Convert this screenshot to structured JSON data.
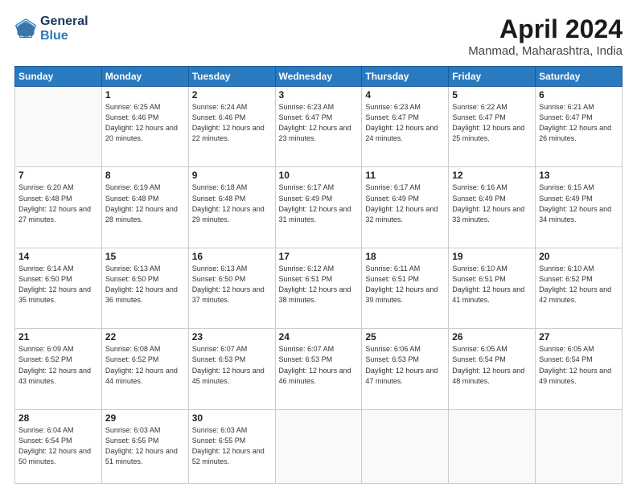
{
  "header": {
    "logo_line1": "General",
    "logo_line2": "Blue",
    "month_year": "April 2024",
    "location": "Manmad, Maharashtra, India"
  },
  "weekdays": [
    "Sunday",
    "Monday",
    "Tuesday",
    "Wednesday",
    "Thursday",
    "Friday",
    "Saturday"
  ],
  "weeks": [
    [
      {
        "day": "",
        "sunrise": "",
        "sunset": "",
        "daylight": ""
      },
      {
        "day": "1",
        "sunrise": "Sunrise: 6:25 AM",
        "sunset": "Sunset: 6:46 PM",
        "daylight": "Daylight: 12 hours and 20 minutes."
      },
      {
        "day": "2",
        "sunrise": "Sunrise: 6:24 AM",
        "sunset": "Sunset: 6:46 PM",
        "daylight": "Daylight: 12 hours and 22 minutes."
      },
      {
        "day": "3",
        "sunrise": "Sunrise: 6:23 AM",
        "sunset": "Sunset: 6:47 PM",
        "daylight": "Daylight: 12 hours and 23 minutes."
      },
      {
        "day": "4",
        "sunrise": "Sunrise: 6:23 AM",
        "sunset": "Sunset: 6:47 PM",
        "daylight": "Daylight: 12 hours and 24 minutes."
      },
      {
        "day": "5",
        "sunrise": "Sunrise: 6:22 AM",
        "sunset": "Sunset: 6:47 PM",
        "daylight": "Daylight: 12 hours and 25 minutes."
      },
      {
        "day": "6",
        "sunrise": "Sunrise: 6:21 AM",
        "sunset": "Sunset: 6:47 PM",
        "daylight": "Daylight: 12 hours and 26 minutes."
      }
    ],
    [
      {
        "day": "7",
        "sunrise": "Sunrise: 6:20 AM",
        "sunset": "Sunset: 6:48 PM",
        "daylight": "Daylight: 12 hours and 27 minutes."
      },
      {
        "day": "8",
        "sunrise": "Sunrise: 6:19 AM",
        "sunset": "Sunset: 6:48 PM",
        "daylight": "Daylight: 12 hours and 28 minutes."
      },
      {
        "day": "9",
        "sunrise": "Sunrise: 6:18 AM",
        "sunset": "Sunset: 6:48 PM",
        "daylight": "Daylight: 12 hours and 29 minutes."
      },
      {
        "day": "10",
        "sunrise": "Sunrise: 6:17 AM",
        "sunset": "Sunset: 6:49 PM",
        "daylight": "Daylight: 12 hours and 31 minutes."
      },
      {
        "day": "11",
        "sunrise": "Sunrise: 6:17 AM",
        "sunset": "Sunset: 6:49 PM",
        "daylight": "Daylight: 12 hours and 32 minutes."
      },
      {
        "day": "12",
        "sunrise": "Sunrise: 6:16 AM",
        "sunset": "Sunset: 6:49 PM",
        "daylight": "Daylight: 12 hours and 33 minutes."
      },
      {
        "day": "13",
        "sunrise": "Sunrise: 6:15 AM",
        "sunset": "Sunset: 6:49 PM",
        "daylight": "Daylight: 12 hours and 34 minutes."
      }
    ],
    [
      {
        "day": "14",
        "sunrise": "Sunrise: 6:14 AM",
        "sunset": "Sunset: 6:50 PM",
        "daylight": "Daylight: 12 hours and 35 minutes."
      },
      {
        "day": "15",
        "sunrise": "Sunrise: 6:13 AM",
        "sunset": "Sunset: 6:50 PM",
        "daylight": "Daylight: 12 hours and 36 minutes."
      },
      {
        "day": "16",
        "sunrise": "Sunrise: 6:13 AM",
        "sunset": "Sunset: 6:50 PM",
        "daylight": "Daylight: 12 hours and 37 minutes."
      },
      {
        "day": "17",
        "sunrise": "Sunrise: 6:12 AM",
        "sunset": "Sunset: 6:51 PM",
        "daylight": "Daylight: 12 hours and 38 minutes."
      },
      {
        "day": "18",
        "sunrise": "Sunrise: 6:11 AM",
        "sunset": "Sunset: 6:51 PM",
        "daylight": "Daylight: 12 hours and 39 minutes."
      },
      {
        "day": "19",
        "sunrise": "Sunrise: 6:10 AM",
        "sunset": "Sunset: 6:51 PM",
        "daylight": "Daylight: 12 hours and 41 minutes."
      },
      {
        "day": "20",
        "sunrise": "Sunrise: 6:10 AM",
        "sunset": "Sunset: 6:52 PM",
        "daylight": "Daylight: 12 hours and 42 minutes."
      }
    ],
    [
      {
        "day": "21",
        "sunrise": "Sunrise: 6:09 AM",
        "sunset": "Sunset: 6:52 PM",
        "daylight": "Daylight: 12 hours and 43 minutes."
      },
      {
        "day": "22",
        "sunrise": "Sunrise: 6:08 AM",
        "sunset": "Sunset: 6:52 PM",
        "daylight": "Daylight: 12 hours and 44 minutes."
      },
      {
        "day": "23",
        "sunrise": "Sunrise: 6:07 AM",
        "sunset": "Sunset: 6:53 PM",
        "daylight": "Daylight: 12 hours and 45 minutes."
      },
      {
        "day": "24",
        "sunrise": "Sunrise: 6:07 AM",
        "sunset": "Sunset: 6:53 PM",
        "daylight": "Daylight: 12 hours and 46 minutes."
      },
      {
        "day": "25",
        "sunrise": "Sunrise: 6:06 AM",
        "sunset": "Sunset: 6:53 PM",
        "daylight": "Daylight: 12 hours and 47 minutes."
      },
      {
        "day": "26",
        "sunrise": "Sunrise: 6:05 AM",
        "sunset": "Sunset: 6:54 PM",
        "daylight": "Daylight: 12 hours and 48 minutes."
      },
      {
        "day": "27",
        "sunrise": "Sunrise: 6:05 AM",
        "sunset": "Sunset: 6:54 PM",
        "daylight": "Daylight: 12 hours and 49 minutes."
      }
    ],
    [
      {
        "day": "28",
        "sunrise": "Sunrise: 6:04 AM",
        "sunset": "Sunset: 6:54 PM",
        "daylight": "Daylight: 12 hours and 50 minutes."
      },
      {
        "day": "29",
        "sunrise": "Sunrise: 6:03 AM",
        "sunset": "Sunset: 6:55 PM",
        "daylight": "Daylight: 12 hours and 51 minutes."
      },
      {
        "day": "30",
        "sunrise": "Sunrise: 6:03 AM",
        "sunset": "Sunset: 6:55 PM",
        "daylight": "Daylight: 12 hours and 52 minutes."
      },
      {
        "day": "",
        "sunrise": "",
        "sunset": "",
        "daylight": ""
      },
      {
        "day": "",
        "sunrise": "",
        "sunset": "",
        "daylight": ""
      },
      {
        "day": "",
        "sunrise": "",
        "sunset": "",
        "daylight": ""
      },
      {
        "day": "",
        "sunrise": "",
        "sunset": "",
        "daylight": ""
      }
    ]
  ]
}
